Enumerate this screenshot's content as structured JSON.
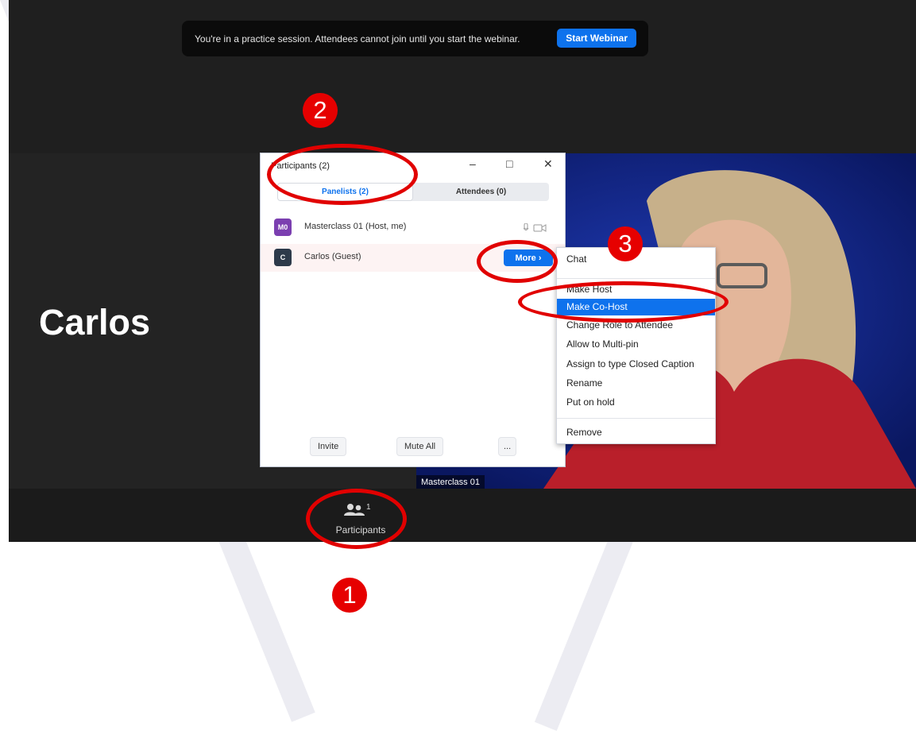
{
  "practice_banner": {
    "text": "You're in a practice session. Attendees cannot join until you start the webinar.",
    "button": "Start Webinar"
  },
  "speaker": {
    "name": "Carlos"
  },
  "video": {
    "label": "Masterclass 01"
  },
  "toolbar": {
    "participants_label": "Participants",
    "participants_count": "1",
    "participants_icon": "people-icon"
  },
  "panel": {
    "title": "Participants (2)",
    "tabs": [
      {
        "label": "Panelists (2)",
        "active": true
      },
      {
        "label": "Attendees (0)",
        "active": false
      }
    ],
    "rows": [
      {
        "initials": "M0",
        "name": "Masterclass 01 (Host, me)",
        "color": "#7b3fb0"
      },
      {
        "initials": "C",
        "name": "Carlos (Guest)",
        "color": "#2d3a4a"
      }
    ],
    "more_button": "More ›",
    "footer": {
      "invite": "Invite",
      "mute_all": "Mute All",
      "more": "..."
    }
  },
  "menu": {
    "items": [
      "Chat",
      "Make Host",
      "Make Co-Host",
      "Change Role to Attendee",
      "Allow to Multi-pin",
      "Assign to type Closed Caption",
      "Rename",
      "Put on hold",
      "Remove"
    ],
    "selected_item": "Make Co-Host"
  },
  "annotations": {
    "badges": [
      "1",
      "2",
      "3"
    ],
    "color": "#e60000"
  },
  "colors": {
    "accent": "#0e72ed",
    "background": "#232323"
  }
}
